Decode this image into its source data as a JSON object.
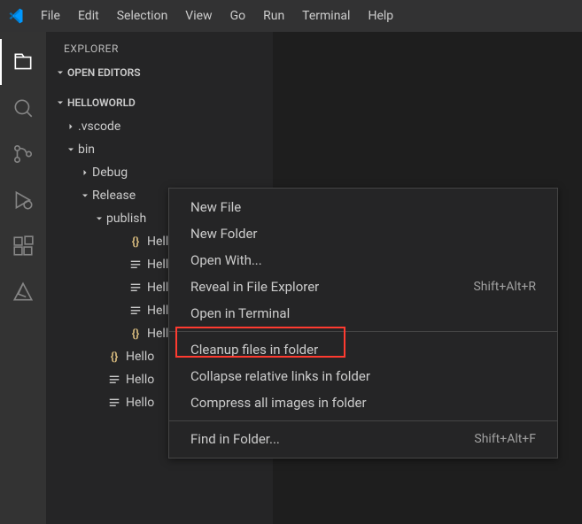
{
  "menu": {
    "items": [
      "File",
      "Edit",
      "Selection",
      "View",
      "Go",
      "Run",
      "Terminal",
      "Help"
    ]
  },
  "sidebar": {
    "title": "Explorer",
    "sections": {
      "openEditors": "Open Editors",
      "workspace": "HelloWorld"
    },
    "tree": {
      "vscode": ".vscode",
      "bin": "bin",
      "debug": "Debug",
      "release": "Release",
      "publish": "publish",
      "file1": "Hell",
      "file2": "Hell",
      "file3": "Hell",
      "file4": "Hell",
      "file5": "Hell",
      "file6": "Hello",
      "file7": "Hello",
      "file8": "Hello"
    }
  },
  "contextMenu": {
    "newFile": "New File",
    "newFolder": "New Folder",
    "openWith": "Open With...",
    "revealExplorer": "Reveal in File Explorer",
    "revealExplorerShortcut": "Shift+Alt+R",
    "openTerminal": "Open in Terminal",
    "cleanupFiles": "Cleanup files in folder",
    "collapseLinks": "Collapse relative links in folder",
    "compressImages": "Compress all images in folder",
    "findInFolder": "Find in Folder...",
    "findInFolderShortcut": "Shift+Alt+F"
  }
}
